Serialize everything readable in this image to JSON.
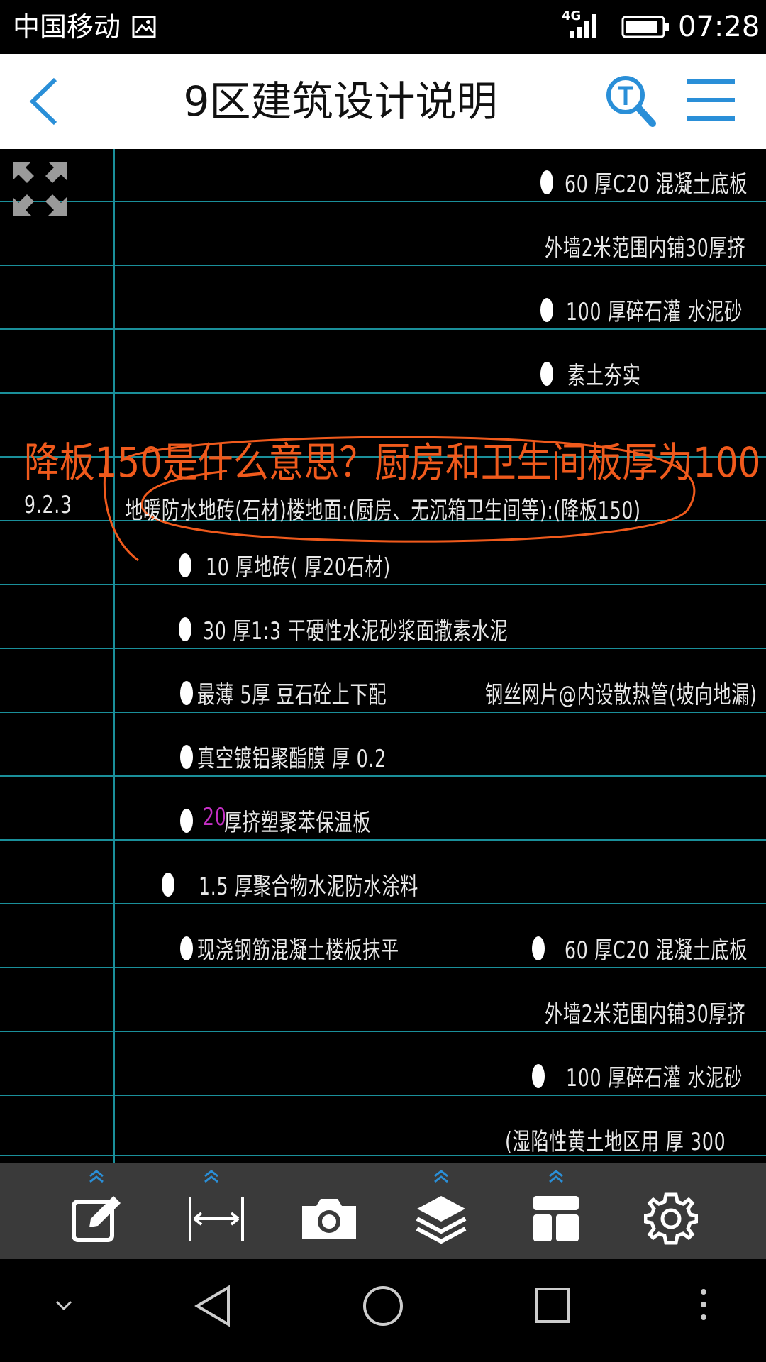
{
  "status_bar": {
    "carrier": "中国移动",
    "network": "4G",
    "time": "07:28"
  },
  "header": {
    "title": "9区建筑设计说明",
    "icons": [
      "back-icon",
      "text-search-icon",
      "menu-icon"
    ],
    "accent_color": "#2a8fd8"
  },
  "drawing": {
    "annotation": "降板150是什么意思？厨房和卫生间板厚为100",
    "annotation_color": "#f05a1c",
    "grid_color": "#1a8f9a",
    "lines": {
      "l1": "60 厚C20 混凝土底板",
      "l2": "外墙2米范围内铺30厚挤",
      "l3": "100 厚碎石灌 水泥砂",
      "l4": "素土夯实",
      "section_num": "9.2.3",
      "section_title": "地暖防水地砖(石材)楼地面:(厨房、无沉箱卫生间等):(降板150)",
      "l5": "10 厚地砖( 厚20石材)",
      "l6": "30 厚1:3 干硬性水泥砂浆面撒素水泥",
      "l7a": "最薄 5厚 豆石砼上下配",
      "l7b": "钢丝网片@内设散热管(坡向地漏)",
      "l8": "真空镀铝聚酯膜 厚 0.2",
      "l9_num": "20",
      "l9": "厚挤塑聚苯保温板",
      "l10": "1.5 厚聚合物水泥防水涂料",
      "l11": "现浇钢筋混凝土楼板抹平",
      "l12": "60 厚C20 混凝土底板",
      "l13": "外墙2米范围内铺30厚挤",
      "l14": "100 厚碎石灌 水泥砂",
      "l15": "(湿陷性黄土地区用 厚 300"
    }
  },
  "toolbar": {
    "icons": [
      "annotate-icon",
      "measure-icon",
      "camera-icon",
      "layers-icon",
      "layout-icon",
      "settings-icon"
    ]
  },
  "navbar": {
    "icons": [
      "hide-nav-icon",
      "back-nav-icon",
      "home-nav-icon",
      "recents-nav-icon",
      "more-icon"
    ]
  }
}
